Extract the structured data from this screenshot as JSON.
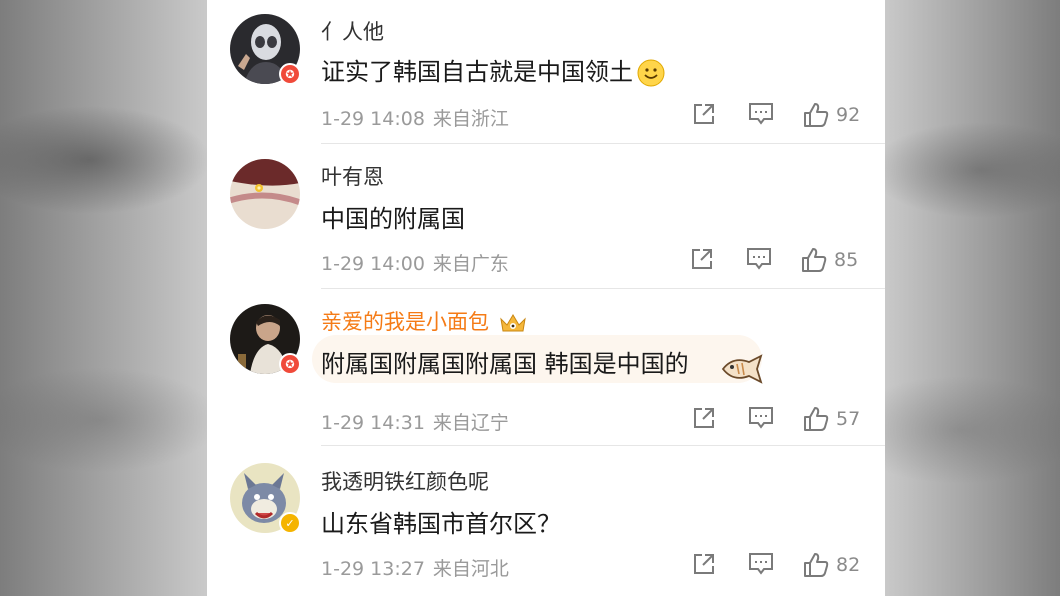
{
  "comments": [
    {
      "username": "亻人他",
      "text": "证实了韩国自古就是中国领土",
      "time": "1-29 14:08",
      "location": "来自浙江",
      "likes": "92",
      "badge": "red"
    },
    {
      "username": "叶有恩",
      "text": "中国的附属国",
      "time": "1-29 14:00",
      "location": "来自广东",
      "likes": "85",
      "badge": "none"
    },
    {
      "username": "亲爱的我是小面包",
      "text": "附属国附属国附属国 韩国是中国的",
      "time": "1-29 14:31",
      "location": "来自辽宁",
      "likes": "57",
      "badge": "red"
    },
    {
      "username": "我透明铁红颜色呢",
      "text": "山东省韩国市首尔区？",
      "time": "1-29 13:27",
      "location": "来自河北",
      "likes": "82",
      "badge": "gold"
    }
  ],
  "colors": {
    "vip_name": "#f57b16",
    "badge_red": "#f04a3a",
    "badge_gold": "#f5b400",
    "meta": "#9a9a9a"
  },
  "icons": [
    "share-icon",
    "comment-icon",
    "like-icon",
    "smile-emoji",
    "crown-icon",
    "fish-emoji"
  ]
}
